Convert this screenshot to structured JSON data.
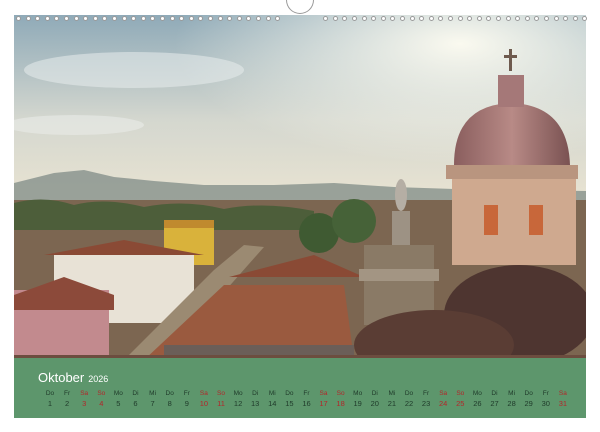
{
  "calendar": {
    "month": "Oktober",
    "year": "2026",
    "days": [
      {
        "dow": "Do",
        "num": "1",
        "weekend": false
      },
      {
        "dow": "Fr",
        "num": "2",
        "weekend": false
      },
      {
        "dow": "Sa",
        "num": "3",
        "weekend": true
      },
      {
        "dow": "So",
        "num": "4",
        "weekend": true
      },
      {
        "dow": "Mo",
        "num": "5",
        "weekend": false
      },
      {
        "dow": "Di",
        "num": "6",
        "weekend": false
      },
      {
        "dow": "Mi",
        "num": "7",
        "weekend": false
      },
      {
        "dow": "Do",
        "num": "8",
        "weekend": false
      },
      {
        "dow": "Fr",
        "num": "9",
        "weekend": false
      },
      {
        "dow": "Sa",
        "num": "10",
        "weekend": true
      },
      {
        "dow": "So",
        "num": "11",
        "weekend": true
      },
      {
        "dow": "Mo",
        "num": "12",
        "weekend": false
      },
      {
        "dow": "Di",
        "num": "13",
        "weekend": false
      },
      {
        "dow": "Mi",
        "num": "14",
        "weekend": false
      },
      {
        "dow": "Do",
        "num": "15",
        "weekend": false
      },
      {
        "dow": "Fr",
        "num": "16",
        "weekend": false
      },
      {
        "dow": "Sa",
        "num": "17",
        "weekend": true
      },
      {
        "dow": "So",
        "num": "18",
        "weekend": true
      },
      {
        "dow": "Mo",
        "num": "19",
        "weekend": false
      },
      {
        "dow": "Di",
        "num": "20",
        "weekend": false
      },
      {
        "dow": "Mi",
        "num": "21",
        "weekend": false
      },
      {
        "dow": "Do",
        "num": "22",
        "weekend": false
      },
      {
        "dow": "Fr",
        "num": "23",
        "weekend": false
      },
      {
        "dow": "Sa",
        "num": "24",
        "weekend": true
      },
      {
        "dow": "So",
        "num": "25",
        "weekend": true
      },
      {
        "dow": "Mo",
        "num": "26",
        "weekend": false
      },
      {
        "dow": "Di",
        "num": "27",
        "weekend": false
      },
      {
        "dow": "Mi",
        "num": "28",
        "weekend": false
      },
      {
        "dow": "Do",
        "num": "29",
        "weekend": false
      },
      {
        "dow": "Fr",
        "num": "30",
        "weekend": false
      },
      {
        "dow": "Sa",
        "num": "31",
        "weekend": true
      }
    ]
  },
  "colors": {
    "band": "#58aa78",
    "weekday_text": "#1f3a2a",
    "weekend_text": "#b3262a",
    "month_text": "#ffffff"
  }
}
